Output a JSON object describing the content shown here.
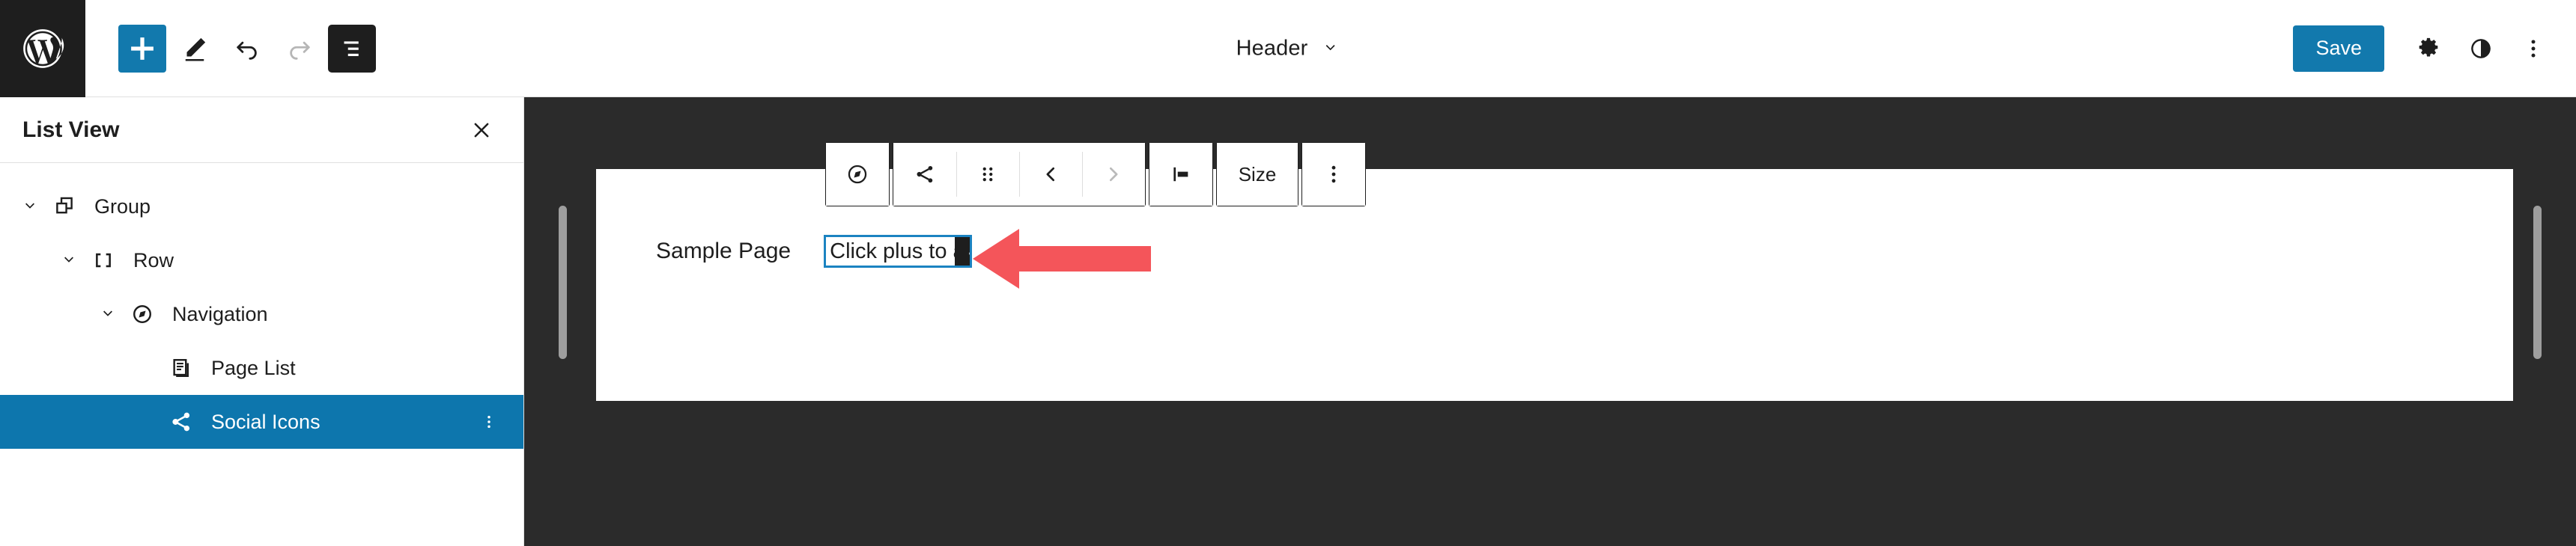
{
  "topbar": {
    "logo_icon": "wordpress-logo-icon",
    "tools": [
      {
        "name": "add-block-button",
        "icon": "plus-icon",
        "state": "primary"
      },
      {
        "name": "edit-tool-button",
        "icon": "pencil-icon",
        "state": "default"
      },
      {
        "name": "undo-button",
        "icon": "undo-arrow-icon",
        "state": "default"
      },
      {
        "name": "redo-button",
        "icon": "redo-arrow-icon",
        "state": "disabled"
      },
      {
        "name": "list-view-toggle",
        "icon": "list-view-icon",
        "state": "active"
      }
    ],
    "document_title": "Header",
    "document_title_chevron": "chevron-down-icon",
    "save_label": "Save",
    "right_icons": [
      {
        "name": "settings-button",
        "icon": "gear-icon"
      },
      {
        "name": "styles-button",
        "icon": "contrast-half-circle-icon"
      },
      {
        "name": "options-button",
        "icon": "vertical-ellipsis-icon"
      }
    ]
  },
  "sidebar": {
    "title": "List View",
    "close_icon": "close-x-icon",
    "items": [
      {
        "label": "Group",
        "icon": "group-stacked-squares-icon",
        "depth": 0,
        "expanded": true,
        "selected": false,
        "has_chevron": true
      },
      {
        "label": "Row",
        "icon": "row-brackets-icon",
        "depth": 1,
        "expanded": true,
        "selected": false,
        "has_chevron": true
      },
      {
        "label": "Navigation",
        "icon": "navigation-compass-icon",
        "depth": 2,
        "expanded": true,
        "selected": false,
        "has_chevron": true
      },
      {
        "label": "Page List",
        "icon": "page-list-document-icon",
        "depth": 3,
        "expanded": false,
        "selected": false,
        "has_chevron": false
      },
      {
        "label": "Social Icons",
        "icon": "share-nodes-icon",
        "depth": 3,
        "expanded": false,
        "selected": true,
        "has_chevron": false,
        "kebab_icon": "vertical-ellipsis-icon"
      }
    ]
  },
  "block_toolbar": {
    "groups": [
      {
        "name": "parent-block-group",
        "buttons": [
          {
            "name": "select-parent-navigation-button",
            "icon": "navigation-compass-icon",
            "label": "",
            "state": "default"
          }
        ]
      },
      {
        "name": "block-controls-group",
        "buttons": [
          {
            "name": "block-type-social-icons-button",
            "icon": "share-nodes-icon",
            "label": "",
            "state": "default"
          },
          {
            "name": "drag-handle-button",
            "icon": "drag-dots-icon",
            "label": "",
            "state": "default"
          },
          {
            "name": "move-left-button",
            "icon": "chevron-left-icon",
            "label": "",
            "state": "default"
          },
          {
            "name": "move-right-button",
            "icon": "chevron-right-icon",
            "label": "",
            "state": "disabled"
          }
        ]
      },
      {
        "name": "alignment-group",
        "buttons": [
          {
            "name": "align-button",
            "icon": "align-left-icon",
            "label": "",
            "state": "default"
          }
        ]
      },
      {
        "name": "size-group",
        "buttons": [
          {
            "name": "size-button",
            "icon": "",
            "label": "Size",
            "state": "default"
          }
        ]
      },
      {
        "name": "more-options-group",
        "buttons": [
          {
            "name": "block-options-button",
            "icon": "vertical-ellipsis-icon",
            "label": "",
            "state": "default"
          }
        ]
      }
    ]
  },
  "canvas": {
    "background_color": "#2b2b2b",
    "page_background": "#ffffff",
    "resize_handle_color": "#9e9e9e",
    "content": {
      "sample_page_label": "Sample Page",
      "nav_placeholder_text": "Click plus to a",
      "nav_placeholder_border_color": "#1b83c1",
      "plus_button_icon": "plus-icon",
      "plus_button_background": "#1e1e1e"
    }
  },
  "annotation": {
    "name": "red-pointer-arrow",
    "direction": "left",
    "color": "#f4555a",
    "points_at": "plus-button"
  },
  "colors": {
    "accent_blue": "#1279ad",
    "selected_blue": "#0d76ad",
    "dark_chrome": "#1e1e1e",
    "canvas_dark": "#2b2b2b",
    "annotation_red": "#f4555a"
  }
}
